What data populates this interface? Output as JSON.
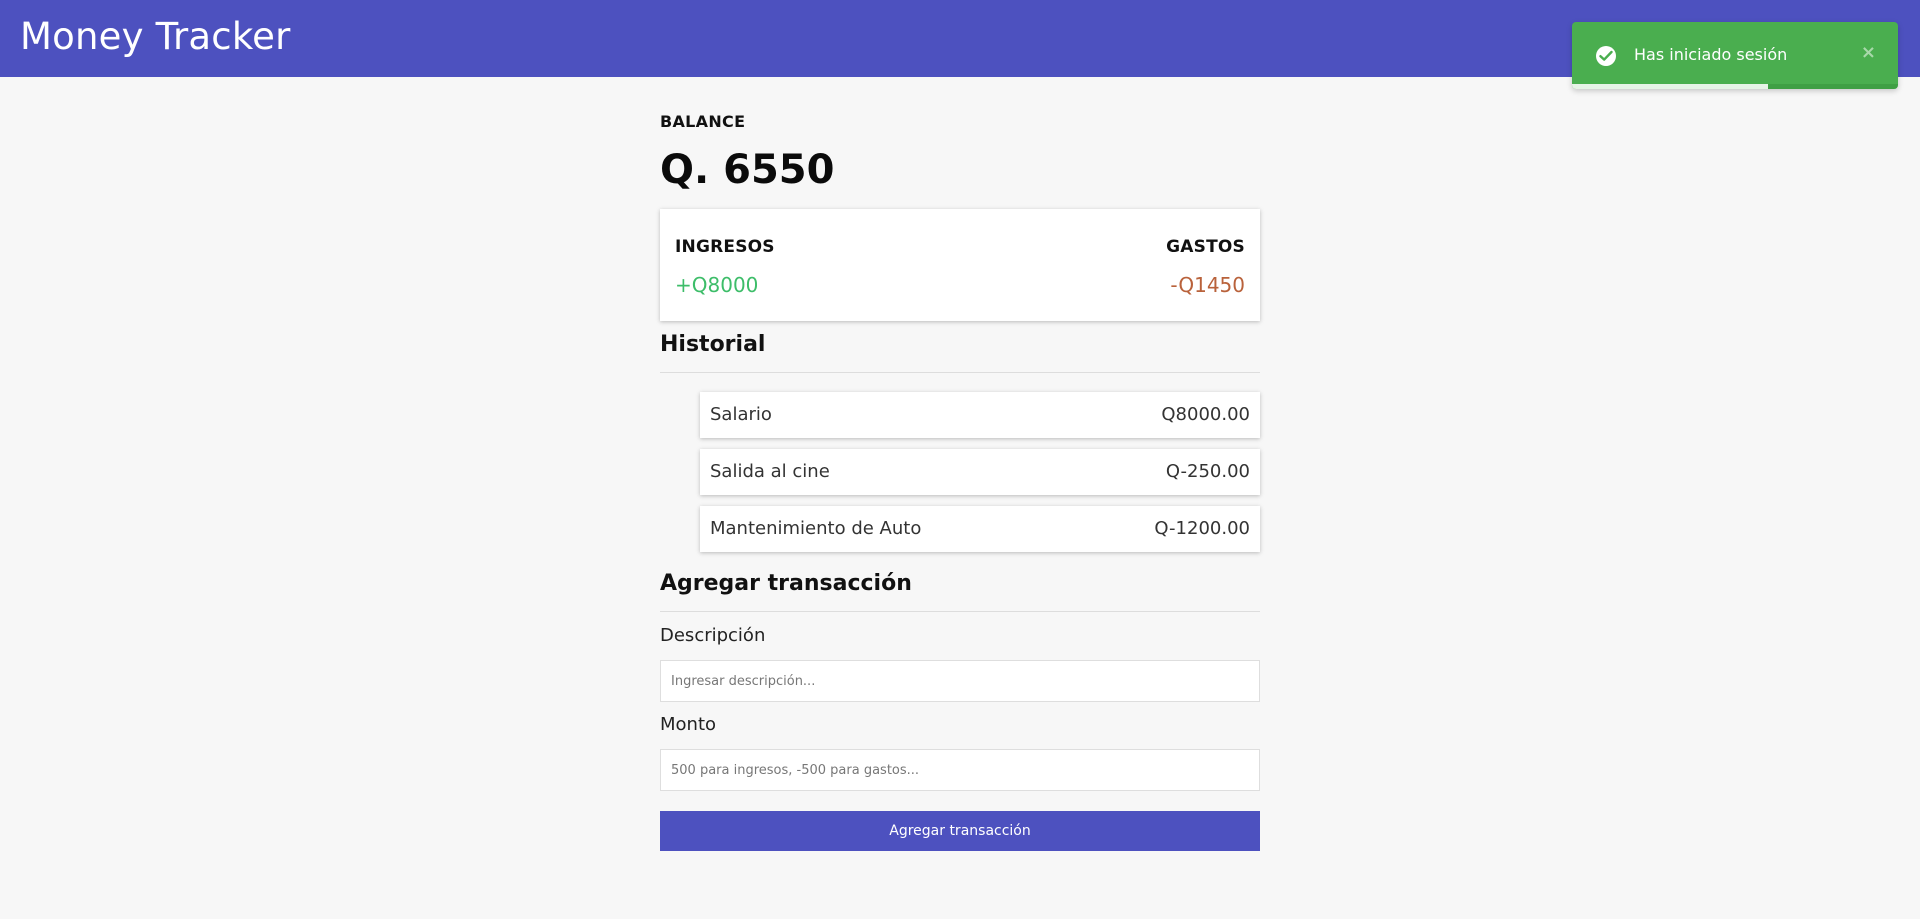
{
  "header": {
    "title": "Money Tracker"
  },
  "balance": {
    "label": "BALANCE",
    "value": "Q. 6550"
  },
  "summary": {
    "income_label": "INGRESOS",
    "income_value": "+Q8000",
    "expense_label": "GASTOS",
    "expense_value": "-Q1450"
  },
  "history": {
    "title": "Historial",
    "items": [
      {
        "description": "Salario",
        "amount": "Q8000.00"
      },
      {
        "description": "Salida al cine",
        "amount": "Q-250.00"
      },
      {
        "description": "Mantenimiento de Auto",
        "amount": "Q-1200.00"
      }
    ]
  },
  "form": {
    "title": "Agregar transacción",
    "description_label": "Descripción",
    "description_placeholder": "Ingresar descripción...",
    "amount_label": "Monto",
    "amount_placeholder": "500 para ingresos, -500 para gastos...",
    "submit_label": "Agregar transacción"
  },
  "toast": {
    "message": "Has iniciado sesión",
    "close_symbol": "×",
    "icon": "check-circle-icon",
    "progress_remaining": 0.4
  },
  "colors": {
    "accent": "#4d51bf",
    "income": "#3dbd69",
    "expense": "#b9623b",
    "toast": "#4aae4f"
  }
}
